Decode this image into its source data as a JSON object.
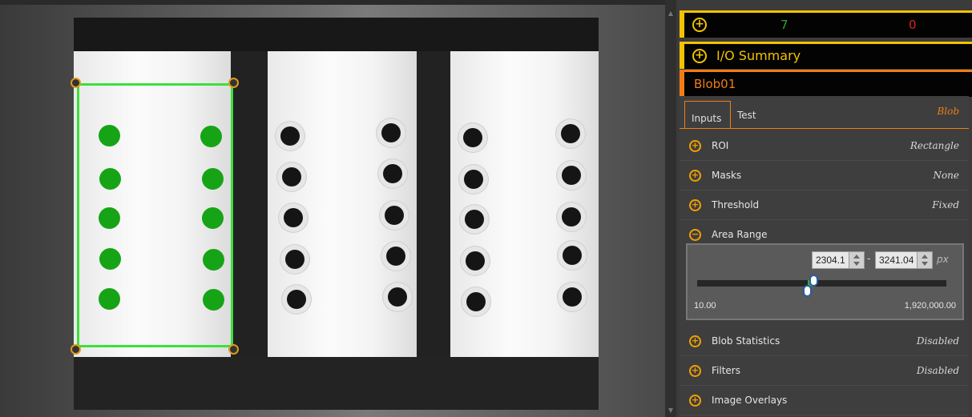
{
  "results": {
    "pass_count": "7",
    "fail_count": "0"
  },
  "io_summary": {
    "label": "I/O Summary"
  },
  "tool": {
    "name": "Blob01",
    "type_label": "Blob"
  },
  "tabs": [
    {
      "label": "Inputs"
    },
    {
      "label": "Test"
    }
  ],
  "settings": [
    {
      "label": "ROI",
      "value": "Rectangle"
    },
    {
      "label": "Masks",
      "value": "None"
    },
    {
      "label": "Threshold",
      "value": "Fixed"
    },
    {
      "label": "Area Range",
      "value": ""
    },
    {
      "label": "Blob Statistics",
      "value": "Disabled"
    },
    {
      "label": "Filters",
      "value": "Disabled"
    },
    {
      "label": "Image Overlays",
      "value": ""
    }
  ],
  "area_range": {
    "min_value": "2304.1",
    "max_value": "3241.04",
    "unit": "px",
    "separator": "-",
    "range_min_label": "10.00",
    "range_max_label": "1,920,000.00"
  },
  "colors": {
    "accent_yellow": "#f2c200",
    "accent_orange": "#f07d16",
    "pass_green": "#2fa32f",
    "fail_red": "#e02020",
    "roi_green": "#3ce03c"
  }
}
